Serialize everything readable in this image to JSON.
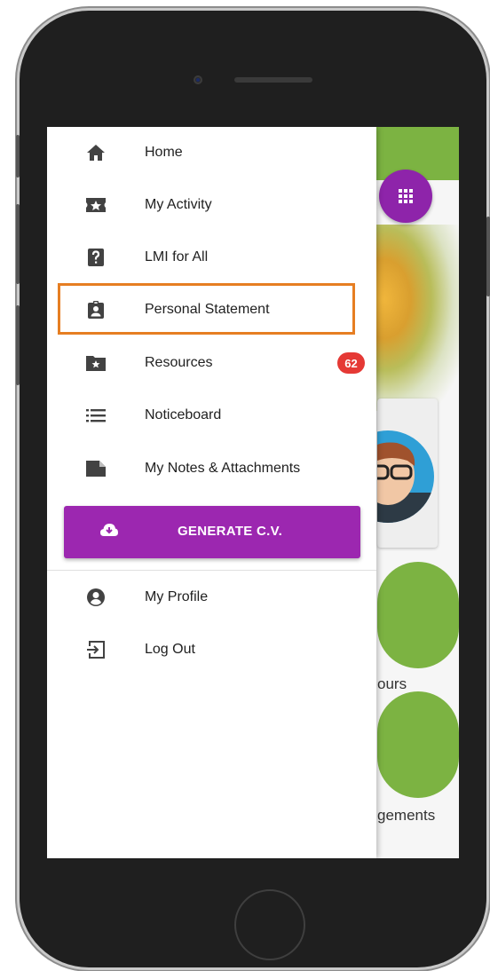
{
  "menu": {
    "items": [
      {
        "label": "Home",
        "icon": "home-icon"
      },
      {
        "label": "My Activity",
        "icon": "star-ticket-icon"
      },
      {
        "label": "LMI for All",
        "icon": "help-box-icon"
      },
      {
        "label": "Personal Statement",
        "icon": "clipboard-account-icon"
      },
      {
        "label": "Resources",
        "icon": "folder-star-icon",
        "badge": "62"
      },
      {
        "label": "Noticeboard",
        "icon": "list-icon"
      },
      {
        "label": "My Notes & Attachments",
        "icon": "note-icon"
      }
    ],
    "generate_cv": {
      "label": "GENERATE C.V.",
      "icon": "cloud-download-icon"
    },
    "account_items": [
      {
        "label": "My Profile",
        "icon": "account-circle-icon"
      },
      {
        "label": "Log Out",
        "icon": "logout-icon"
      }
    ]
  },
  "background": {
    "text_1": "ours",
    "text_2": "gements"
  },
  "colors": {
    "accent_purple": "#9c27b0",
    "topbar_green": "#7cb342",
    "badge_red": "#e53935",
    "highlight_orange": "#e67e22"
  }
}
